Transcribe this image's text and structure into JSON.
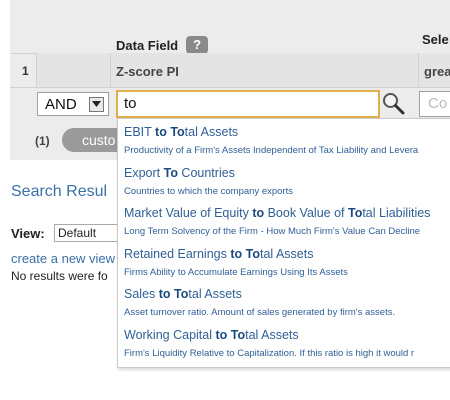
{
  "grid": {
    "data_field_header": "Data Field",
    "help_icon_glyph": "?",
    "select_header": "Sele",
    "row_number": "1",
    "field_name": "Z-score PI",
    "operator_name": "grea",
    "conjunction_value": "AND",
    "search_value": "to",
    "value_placeholder": "Co",
    "count_label": "(1)",
    "custom_button_label": "custo"
  },
  "page": {
    "search_results_heading": "Search Resul",
    "view_label": "View:",
    "view_value": "Default",
    "create_link": "create a new view",
    "no_results_text": "No results were fo"
  },
  "suggestions": [
    {
      "parts": [
        {
          "t": "EBIT "
        },
        {
          "t": "to",
          "b": true
        },
        {
          "t": " "
        },
        {
          "t": "To",
          "b": true
        },
        {
          "t": "tal Assets"
        }
      ],
      "description": "Productivity of a Firm's Assets Independent of Tax Liability and Levera"
    },
    {
      "parts": [
        {
          "t": "Export "
        },
        {
          "t": "To",
          "b": true
        },
        {
          "t": " Countries"
        }
      ],
      "description": "Countries to which the company exports"
    },
    {
      "parts": [
        {
          "t": "Market Value of Equity "
        },
        {
          "t": "to",
          "b": true
        },
        {
          "t": " Book Value of "
        },
        {
          "t": "To",
          "b": true
        },
        {
          "t": "tal Liabilities"
        }
      ],
      "description": "Long Term Solvency of the Firm - How Much Firm's Value Can Decline"
    },
    {
      "parts": [
        {
          "t": "Retained Earnings "
        },
        {
          "t": "to",
          "b": true
        },
        {
          "t": " "
        },
        {
          "t": "To",
          "b": true
        },
        {
          "t": "tal Assets"
        }
      ],
      "description": "Firms Ability to Accumulate Earnings Using Its Assets"
    },
    {
      "parts": [
        {
          "t": "Sales "
        },
        {
          "t": "to",
          "b": true
        },
        {
          "t": " "
        },
        {
          "t": "To",
          "b": true
        },
        {
          "t": "tal Assets"
        }
      ],
      "description": "Asset turnover ratio. Amount of sales generated by firm's assets."
    },
    {
      "parts": [
        {
          "t": "Working Capital "
        },
        {
          "t": "to",
          "b": true
        },
        {
          "t": " "
        },
        {
          "t": "To",
          "b": true
        },
        {
          "t": "tal Assets"
        }
      ],
      "description": "Firm's Liquidity Relative to Capitalization. If this ratio is high it would r"
    }
  ],
  "colors": {
    "link": "#3a6fa8",
    "input_focus_border": "#e0b050",
    "panel_bg": "#ececec"
  }
}
